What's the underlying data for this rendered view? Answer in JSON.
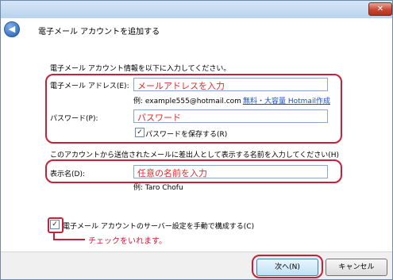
{
  "window": {
    "title": "電子メール アカウントを追加する",
    "close_glyph": "✕",
    "back_glyph": "◀"
  },
  "intro": "電子メール アカウント情報を以下に入力してください。",
  "email": {
    "label": "電子メール アドレス(E):",
    "value": "メールアドレスを入力",
    "example": "例: example555@hotmail.com",
    "link": "無料・大容量 Hotmail作成"
  },
  "password": {
    "label": "パスワード(P):",
    "value": "パスワード",
    "save_label": "パスワードを保存する(R)",
    "save_checked": true
  },
  "display": {
    "instruction": "このアカウントから送信されたメールに差出人として表示する名前を入力してください(H)",
    "label": "表示名(D):",
    "value": "任意の名前を入力",
    "example": "例: Taro Chofu"
  },
  "manual": {
    "label": "電子メール アカウントのサーバー設定を手動で構成する(C)",
    "checked": true,
    "check_glyph": "✓"
  },
  "annotation": "チェックをいれます。",
  "buttons": {
    "next": "次へ(N)",
    "cancel": "キャンセル"
  },
  "colors": {
    "annotation_red": "#c5213a",
    "input_text_red": "#e3292b",
    "link_blue": "#1a4ccd"
  }
}
